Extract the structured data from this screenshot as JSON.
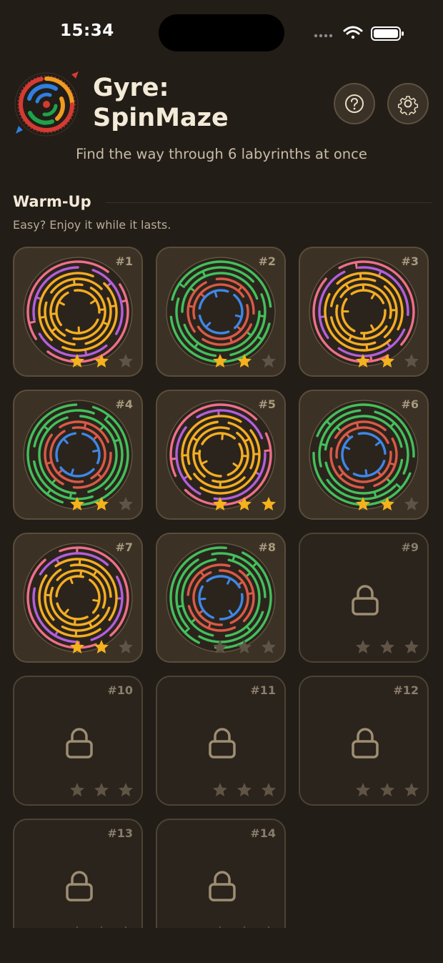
{
  "status_bar": {
    "time": "15:34"
  },
  "header": {
    "title_line1": "Gyre:",
    "title_line2": "SpinMaze",
    "subtitle": "Find the way through 6 labyrinths at once"
  },
  "icons": {
    "help": "help-icon",
    "settings": "gear-icon",
    "lock": "lock-icon",
    "star": "star-icon"
  },
  "colors": {
    "background": "#221d17",
    "star_filled": "#f4b21c",
    "star_empty": "#5f5445",
    "maze_pink": "#ef6f8a",
    "maze_purple": "#b45fdc",
    "maze_orange": "#f4ad23",
    "maze_green": "#43c05c",
    "maze_red": "#d95a48",
    "maze_blue": "#3f87e8"
  },
  "section": {
    "title": "Warm-Up",
    "subtitle": "Easy? Enjoy it while it lasts."
  },
  "levels": [
    {
      "number": "#1",
      "locked": false,
      "stars": 2,
      "theme": "warm"
    },
    {
      "number": "#2",
      "locked": false,
      "stars": 2,
      "theme": "cool"
    },
    {
      "number": "#3",
      "locked": false,
      "stars": 2,
      "theme": "warm"
    },
    {
      "number": "#4",
      "locked": false,
      "stars": 2,
      "theme": "cool"
    },
    {
      "number": "#5",
      "locked": false,
      "stars": 3,
      "theme": "warm"
    },
    {
      "number": "#6",
      "locked": false,
      "stars": 2,
      "theme": "cool"
    },
    {
      "number": "#7",
      "locked": false,
      "stars": 2,
      "theme": "warm"
    },
    {
      "number": "#8",
      "locked": false,
      "stars": 0,
      "theme": "cool"
    },
    {
      "number": "#9",
      "locked": true,
      "stars": 0
    },
    {
      "number": "#10",
      "locked": true,
      "stars": 0
    },
    {
      "number": "#11",
      "locked": true,
      "stars": 0
    },
    {
      "number": "#12",
      "locked": true,
      "stars": 0
    },
    {
      "number": "#13",
      "locked": true,
      "stars": 0
    },
    {
      "number": "#14",
      "locked": true,
      "stars": 0
    }
  ]
}
